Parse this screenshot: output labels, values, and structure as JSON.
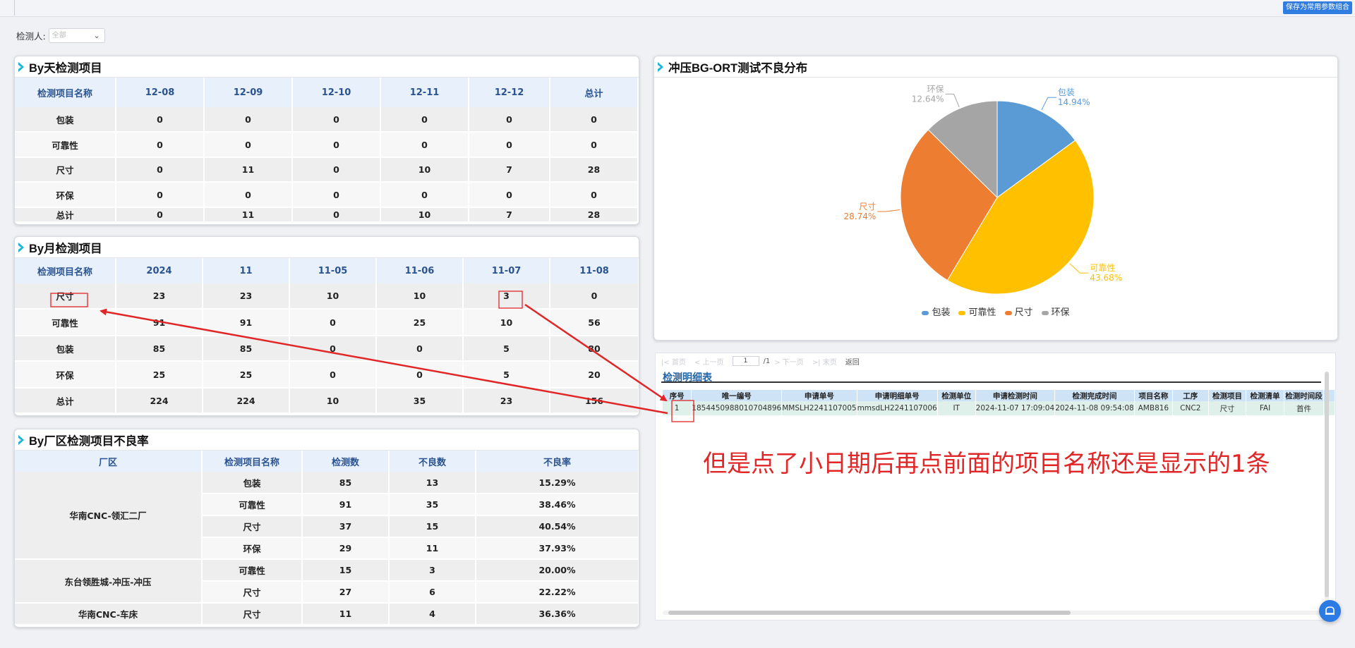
{
  "toolbar": {
    "save_label": "保存为常用参数组合"
  },
  "filter": {
    "label": "检测人:",
    "value": "全部"
  },
  "daily": {
    "title": "By天检测项目",
    "headers": [
      "检测项目名称",
      "12-08",
      "12-09",
      "12-10",
      "12-11",
      "12-12",
      "总计"
    ],
    "rows": [
      [
        "包装",
        "0",
        "0",
        "0",
        "0",
        "0",
        "0"
      ],
      [
        "可靠性",
        "0",
        "0",
        "0",
        "0",
        "0",
        "0"
      ],
      [
        "尺寸",
        "0",
        "11",
        "0",
        "10",
        "7",
        "28"
      ],
      [
        "环保",
        "0",
        "0",
        "0",
        "0",
        "0",
        "0"
      ],
      [
        "总计",
        "0",
        "11",
        "0",
        "10",
        "7",
        "28"
      ]
    ]
  },
  "monthly": {
    "title": "By月检测项目",
    "headers": [
      "检测项目名称",
      "2024",
      "11",
      "11-05",
      "11-06",
      "11-07",
      "11-08"
    ],
    "rows": [
      [
        "尺寸",
        "23",
        "23",
        "10",
        "10",
        "3",
        "0"
      ],
      [
        "可靠性",
        "91",
        "91",
        "0",
        "25",
        "10",
        "56"
      ],
      [
        "包装",
        "85",
        "85",
        "0",
        "0",
        "5",
        "80"
      ],
      [
        "环保",
        "25",
        "25",
        "0",
        "0",
        "5",
        "20"
      ],
      [
        "总计",
        "224",
        "224",
        "10",
        "35",
        "23",
        "156"
      ]
    ]
  },
  "factory": {
    "title": "By厂区检测项目不良率",
    "headers": [
      "厂区",
      "检测项目名称",
      "检测数",
      "不良数",
      "不良率"
    ],
    "groups": [
      {
        "name": "华南CNC-领汇二厂",
        "rows": [
          [
            "包装",
            "85",
            "13",
            "15.29%"
          ],
          [
            "可靠性",
            "91",
            "35",
            "38.46%"
          ],
          [
            "尺寸",
            "37",
            "15",
            "40.54%"
          ],
          [
            "环保",
            "29",
            "11",
            "37.93%"
          ]
        ]
      },
      {
        "name": "东台领胜城-冲压-冲压",
        "rows": [
          [
            "可靠性",
            "15",
            "3",
            "20.00%"
          ],
          [
            "尺寸",
            "27",
            "6",
            "22.22%"
          ]
        ]
      },
      {
        "name": "华南CNC-车床",
        "rows": [
          [
            "尺寸",
            "11",
            "4",
            "36.36%"
          ]
        ]
      }
    ]
  },
  "pie": {
    "title": "冲压BG-ORT测试不良分布",
    "legend": [
      "包装",
      "可靠性",
      "尺寸",
      "环保"
    ]
  },
  "chart_data": {
    "type": "pie",
    "title": "冲压BG-ORT测试不良分布",
    "categories": [
      "包装",
      "可靠性",
      "尺寸",
      "环保"
    ],
    "values": [
      14.94,
      43.68,
      28.74,
      12.64
    ],
    "value_labels": [
      "14.94%",
      "43.68%",
      "28.74%",
      "12.64%"
    ],
    "colors": [
      "#5b9bd5",
      "#ffc000",
      "#ed7d31",
      "#a5a5a5"
    ],
    "legend_position": "bottom"
  },
  "detail": {
    "pager": {
      "first": "首页",
      "prev": "上一页",
      "page": "1",
      "total": "/1",
      "next": "下一页",
      "last": "末页",
      "back": "返回"
    },
    "title": "检测明细表",
    "headers": [
      "序号",
      "唯一编号",
      "申请单号",
      "申请明细单号",
      "检测单位",
      "申请检测时间",
      "检测完成时间",
      "项目名称",
      "工序",
      "检测项目",
      "检测清单",
      "检测时间段"
    ],
    "rows": [
      [
        "1",
        "1854450988010704896",
        "MMSLH2241107005",
        "mmsdLH2241107006",
        "IT",
        "2024-11-07 17:09:04",
        "2024-11-08 09:54:08",
        "AMB816",
        "CNC2",
        "尺寸",
        "FAI",
        "首件"
      ]
    ]
  },
  "annotation": {
    "text": "但是点了小日期后再点前面的项目名称还是显示的1条"
  }
}
